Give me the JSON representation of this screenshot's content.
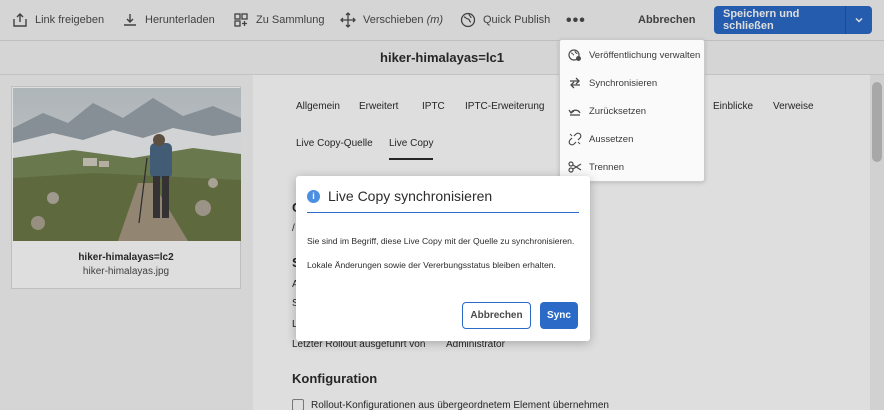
{
  "toolbar": {
    "link_share": "Link freigeben",
    "download": "Herunterladen",
    "to_collection": "Zu Sammlung",
    "move": "Verschieben",
    "move_shortcut": "(m)",
    "quick_publish": "Quick Publish",
    "more": "•••",
    "cancel": "Abbrechen",
    "save_close": "Speichern und schließen"
  },
  "title": "hiker-himalayas=lc1",
  "card": {
    "title": "hiker-himalayas=lc2",
    "subtitle": "hiker-himalayas.jpg"
  },
  "tabs_row1": [
    "Allgemein",
    "Erweitert",
    "IPTC",
    "IPTC-Erweiterung",
    "Einblicke",
    "Verweise"
  ],
  "tabs_row2": [
    "Live Copy-Quelle",
    "Live Copy"
  ],
  "panel": {
    "letzter_rollout_label": "Letzter Rollout ausgeführt von",
    "letzter_rollout_value": "Administrator",
    "config_heading": "Konfiguration",
    "inherit_label": "Rollout-Konfigurationen aus übergeordnetem Element übernehmen",
    "partial_c": "C",
    "partial_slash": "/",
    "partial_s": "S",
    "partial_a": "A",
    "partial_s2": "S",
    "partial_l": "L"
  },
  "menu": {
    "items": [
      {
        "label": "Veröffentlichung verwalten",
        "icon": "globe-publish-icon"
      },
      {
        "label": "Synchronisieren",
        "icon": "sync-arrows-icon"
      },
      {
        "label": "Zurücksetzen",
        "icon": "undo-icon"
      },
      {
        "label": "Aussetzen",
        "icon": "unlink-icon"
      },
      {
        "label": "Trennen",
        "icon": "scissors-icon"
      }
    ]
  },
  "dialog": {
    "title": "Live Copy synchronisieren",
    "line1": "Sie sind im Begriff, diese Live Copy mit der Quelle zu synchronisieren.",
    "line2": "Lokale Änderungen sowie der Vererbungsstatus bleiben erhalten.",
    "cancel": "Abbrechen",
    "sync": "Sync"
  },
  "colors": {
    "primary": "#2c6ac8",
    "info": "#4b8ee2"
  }
}
